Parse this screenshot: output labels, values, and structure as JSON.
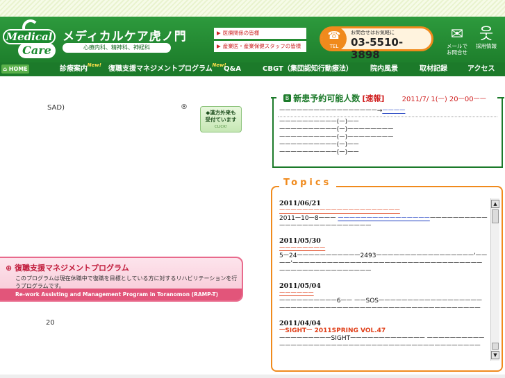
{
  "header": {
    "logo_top": "Medical",
    "logo_bottom": "Care",
    "title": "メディカルケア虎ノ門",
    "subtitle": "心療内科、精神科、神経科",
    "notice1": "医療関係の皆様",
    "notice2": "産業医・産業保健スタッフの皆様",
    "tel_label": "お問合せはお気軽に",
    "tel_number": "03-5510-3898",
    "tel_icon_text": "TEL",
    "mail_label": "メールで\nお問合せ",
    "recruit_label": "採用情報"
  },
  "nav": {
    "home": "HOME",
    "items": [
      {
        "label": "診療案内",
        "badge": "New!"
      },
      {
        "label": "復職支援マネジメントプログラム",
        "badge": "New!"
      },
      {
        "label": "Q&A"
      },
      {
        "label": "CBGT（集団認知行動療法）"
      },
      {
        "label": "院内風景"
      },
      {
        "label": "取材記録"
      },
      {
        "label": "アクセス"
      }
    ]
  },
  "left": {
    "sad": "SAD)",
    "registered": "®",
    "kampo_line1": "漢方外来も",
    "kampo_line2": "受付ています",
    "kampo_click": "CLICK!",
    "ramp_title": "復職支援マネジメントプログラム",
    "ramp_desc": "このプログラムは現在休職中で復職を目標としている方に対するリハビリテーションを行うプログラムです。",
    "ramp_en": "Re-work Assisting and Management Program in Toranomon (RAMP-T)",
    "num20": "20"
  },
  "new_patients": {
    "icon": "B",
    "title": "新患予約可能人数",
    "flash": "[速報]",
    "date": "2011/7/ 1(ￚ) 20ￚ00ￚￚ",
    "line1": "ￚￚￚￚￚￚￚￚￚￚￚￚￚￚￚￚￚ→",
    "line1_link": "ￚￚￚￚ",
    "rows": [
      "ￚￚￚￚￚￚￚￚￚￚ(ￚ)ￚￚ",
      "ￚￚￚￚￚￚￚￚￚￚ(ￚ)ￚￚￚￚￚￚￚￚ",
      "ￚￚￚￚￚￚￚￚￚￚ(ￚ)ￚￚￚￚￚￚￚￚ",
      "ￚￚￚￚￚￚￚￚￚￚ(ￚ)ￚￚ",
      "ￚￚￚￚￚￚￚￚￚￚ(ￚ)ￚￚ"
    ]
  },
  "topics": {
    "heading": "Topics",
    "items": [
      {
        "date": "2011/06/21",
        "title": "ￚￚￚￚￚￚￚￚￚￚￚￚￚￚￚￚￚￚￚￚￚ",
        "body_pre": "2011ￚ10ￚ8ￚￚￚ ",
        "body_link": "ￚￚￚￚￚￚￚￚￚￚￚￚￚￚￚￚ",
        "body_post": "ￚￚￚￚￚￚￚￚￚￚￚￚￚￚￚￚￚￚￚￚￚￚￚￚￚￚ"
      },
      {
        "date": "2011/05/30",
        "title": "ￚￚￚￚￚￚￚￚ",
        "body_pre": "5ￚ24ￚￚￚￚￚￚￚￚￚￚￚ2493ￚￚￚￚￚￚￚￚￚￚￚￚￚￚￚￚￚ'ￚￚￚￚ'ￚￚￚￚￚￚￚￚￚￚￚￚￚￚￚￚￚￚￚￚￚￚￚￚￚￚￚￚￚￚￚￚￚￚￚￚￚￚￚￚￚￚￚￚￚￚￚￚￚ",
        "body_link": "",
        "body_post": ""
      },
      {
        "date": "2011/05/04",
        "title": "ￚￚￚￚￚￚ",
        "body_pre": "ￚￚￚￚￚￚￚￚￚￚ6ￚￚ ￚￚSOSￚￚￚￚￚￚￚￚￚￚￚￚￚￚￚￚￚￚￚￚￚￚￚￚￚￚￚￚￚￚￚￚￚￚￚￚￚￚￚￚￚￚￚￚￚￚￚￚￚￚￚￚￚ",
        "body_link": "",
        "body_post": ""
      },
      {
        "date": "2011/04/04",
        "title": "ￚSIGHTￚ 2011SPRING VOL.47",
        "body_pre": "ￚￚￚￚￚￚￚￚￚSIGHTￚￚￚￚￚￚￚￚￚￚￚￚￚ ￚￚￚￚￚￚￚￚￚￚￚￚￚￚￚￚￚￚￚￚￚￚￚￚￚￚￚￚￚￚￚￚￚￚￚￚￚￚￚￚￚￚￚￚￚ",
        "body_link": "",
        "body_post": ""
      }
    ]
  },
  "colors": {
    "header_green": "#1e7f2c",
    "accent_orange": "#f08a1c",
    "flash_red": "#d02020",
    "ramp_pink": "#e2557a"
  }
}
